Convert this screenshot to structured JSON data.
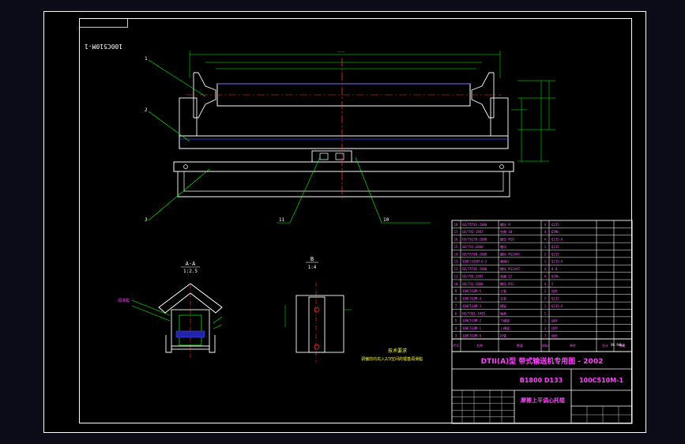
{
  "drawing": {
    "code_stamp": "100C510M-1",
    "section_aa": {
      "label": "A-A",
      "scale": "1:2.5"
    },
    "view_b": {
      "label": "B",
      "scale": "1:4"
    },
    "leaders": [
      "1",
      "2",
      "3",
      "11",
      "10"
    ],
    "tech_req_title": "技术要求",
    "tech_req_text": "调偏前内充入2/3空间的锂基润滑脂",
    "note_left_label": "润滑脂",
    "colors": {
      "frame": "#ffffff",
      "dim": "#00ff00",
      "title": "#ff44ff",
      "centerline": "#ff3333",
      "hidden": "#4444ff"
    }
  },
  "title_block": {
    "series": "DTII(A)型 带式输送机专用图 - 2002",
    "spec": "B1800  D133",
    "drawing_no": "100C510M-1",
    "name": "摩擦上平调心托辊",
    "mass": "98.94kg",
    "headers": [
      "代号",
      "名称",
      "数量",
      "材料",
      "单件",
      "总计",
      "备注"
    ]
  },
  "parts_table": [
    {
      "no": "18",
      "code": "GB/T5781-2000",
      "name": "螺栓 M",
      "qty": "4",
      "mat": "Q235"
    },
    {
      "no": "17",
      "code": "GB/T93-1987",
      "name": "垫圈 10",
      "qty": "4",
      "mat": "65Mn"
    },
    {
      "no": "16",
      "code": "GB/T6170-2000",
      "name": "螺母 M10",
      "qty": "4",
      "mat": "Q235-A"
    },
    {
      "no": "15",
      "code": "GB/T41-2000",
      "name": "螺母",
      "qty": "1",
      "mat": "Q235"
    },
    {
      "no": "14",
      "code": "GB/T5780-2000",
      "name": "螺栓 M12X45",
      "qty": "1",
      "mat": "Q235"
    },
    {
      "no": "13",
      "code": "100C1101M-6-3",
      "name": "摩擦片",
      "qty": "1",
      "mat": "Q235-A"
    },
    {
      "no": "12",
      "code": "GB/T5782-2000",
      "name": "螺栓 M12X45",
      "qty": "4",
      "mat": "8.8"
    },
    {
      "no": "11",
      "code": "GB/T93-1987",
      "name": "垫圈 12",
      "qty": "4",
      "mat": "65Mn"
    },
    {
      "no": "10",
      "code": "GB/T41-2000",
      "name": "螺母 M12",
      "qty": "4",
      "mat": "5"
    },
    {
      "no": "9",
      "code": "100C510M-5",
      "name": "立辊",
      "qty": "2",
      "mat": "组件"
    },
    {
      "no": "8",
      "code": "100C510M-4",
      "name": "支架",
      "qty": "1",
      "mat": "Q235"
    },
    {
      "no": "7",
      "code": "100C510M-3",
      "name": "横梁",
      "qty": "1",
      "mat": "Q235-A"
    },
    {
      "no": "6",
      "code": "GB/T301-1995",
      "name": "轴承",
      "qty": "1",
      "mat": ""
    },
    {
      "no": "5",
      "code": "100C510M-2",
      "name": "下横梁",
      "qty": "1",
      "mat": "组件"
    },
    {
      "no": "4",
      "code": "100C510M-1",
      "name": "上横梁",
      "qty": "1",
      "mat": "组件"
    },
    {
      "no": "3",
      "code": "100C510M-6",
      "name": "托辊",
      "qty": "3",
      "mat": "组件"
    }
  ]
}
